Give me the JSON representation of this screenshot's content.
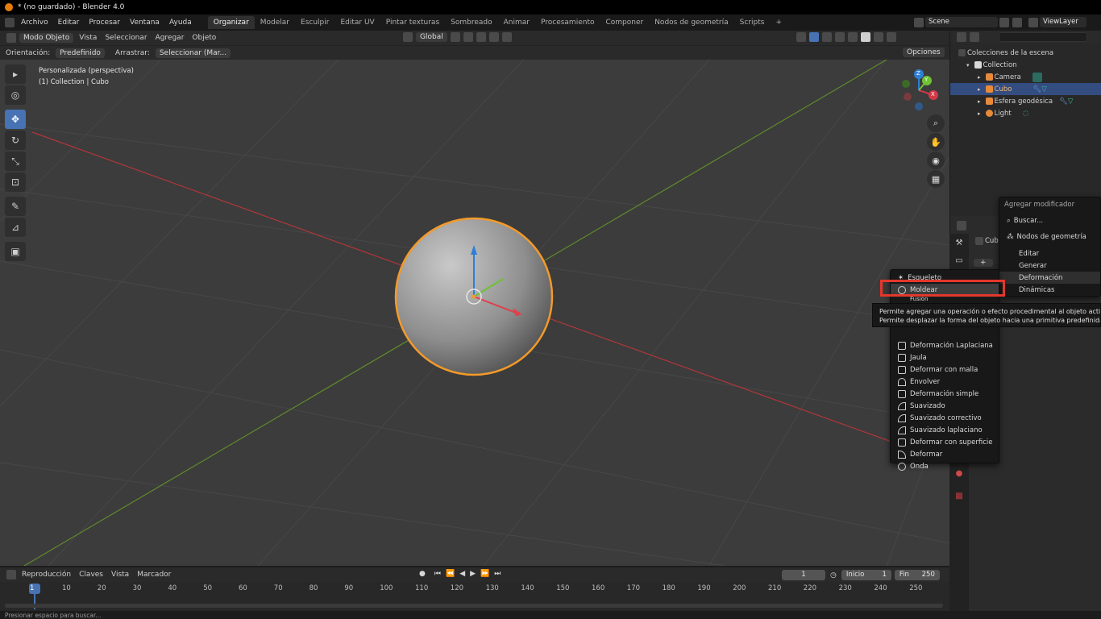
{
  "window": {
    "title": "* (no guardado) - Blender 4.0"
  },
  "menubar": {
    "menus": [
      "Archivo",
      "Editar",
      "Procesar",
      "Ventana",
      "Ayuda"
    ],
    "workspaces": [
      "Organizar",
      "Modelar",
      "Esculpir",
      "Editar UV",
      "Pintar texturas",
      "Sombreado",
      "Animar",
      "Procesamiento",
      "Componer",
      "Nodos de geometría",
      "Scripts"
    ],
    "active_workspace": "Organizar",
    "add_tab": "+",
    "scene": "Scene",
    "view_layer": "ViewLayer"
  },
  "viewport_header": {
    "mode": "Modo Objeto",
    "menus": [
      "Vista",
      "Seleccionar",
      "Agregar",
      "Objeto"
    ],
    "transform": "Global",
    "orientation_label": "Orientación:",
    "orientation_value": "Predefinido",
    "drag_label": "Arrastrar:",
    "drag_value": "Seleccionar (Mar...",
    "options": "Opciones"
  },
  "viewport": {
    "view_name": "Personalizada (perspectiva)",
    "context": "(1) Collection | Cubo",
    "gizmo": {
      "z": "Z",
      "y": "Y",
      "x": "X"
    }
  },
  "outliner": {
    "search_placeholder": "",
    "root": "Colecciones de la escena",
    "collection": "Collection",
    "items": [
      {
        "name": "Camera",
        "selected": false
      },
      {
        "name": "Cubo",
        "selected": true
      },
      {
        "name": "Esfera geodésica",
        "selected": false
      },
      {
        "name": "Light",
        "selected": false
      }
    ]
  },
  "properties": {
    "object_name": "Cub",
    "add_button": "+"
  },
  "add_modifier_menu": {
    "title": "Agregar modificador",
    "search": "Buscar...",
    "geometry_nodes": "Nodos de geometría",
    "categories": [
      "Editar",
      "Generar",
      "Deformación",
      "Dinámicas"
    ],
    "active_category": "Deformación"
  },
  "deform_menu": {
    "items": [
      "Esqueleto",
      "Moldear"
    ],
    "hidden_partial": "Fusión",
    "items_below": [
      "Deformación Laplaciana",
      "Jaula",
      "Deformar con malla",
      "Envolver",
      "Deformación simple",
      "Suavizado",
      "Suavizado correctivo",
      "Suavizado laplaciano",
      "Deformar con superficie",
      "Deformar",
      "Onda"
    ],
    "highlighted": "Moldear"
  },
  "tooltip": {
    "line1": "Permite agregar una operación o efecto procedimental al objeto activo:",
    "line2": "Permite desplazar la forma del objeto hacia una primitiva predefinida"
  },
  "timeline": {
    "menus": [
      "Reproducción",
      "Claves",
      "Vista",
      "Marcador"
    ],
    "current_frame": "1",
    "start_label": "Inicio",
    "start": "1",
    "end_label": "Fin",
    "end": "250",
    "ticks": [
      "1",
      "10",
      "20",
      "30",
      "40",
      "50",
      "60",
      "70",
      "80",
      "90",
      "100",
      "110",
      "120",
      "130",
      "140",
      "150",
      "160",
      "170",
      "180",
      "190",
      "200",
      "210",
      "220",
      "230",
      "240",
      "250"
    ]
  },
  "statusbar": {
    "text": "Presionar espacio para buscar..."
  },
  "colors": {
    "accent": "#4772b3",
    "selection_orange": "#f39a2a",
    "highlight_box": "#e4372c"
  }
}
